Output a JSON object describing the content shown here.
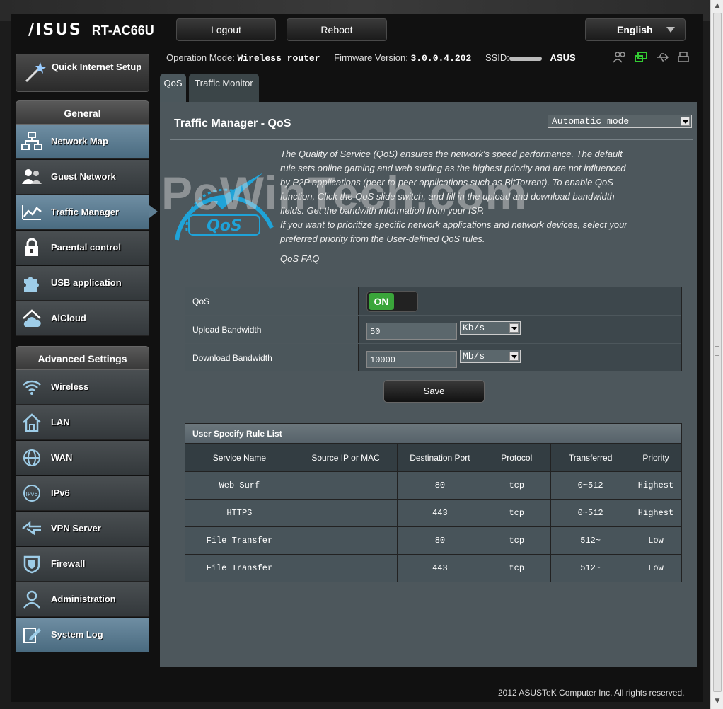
{
  "header": {
    "brand": "/ISUS",
    "model": "RT-AC66U",
    "logout": "Logout",
    "reboot": "Reboot",
    "language": "English"
  },
  "infobar": {
    "op_mode_label": "Operation Mode:",
    "op_mode_value": "Wireless router",
    "fw_label": "Firmware Version:",
    "fw_value": "3.0.0.4.202",
    "ssid_label": "SSID:",
    "ssid_value": "ASUS"
  },
  "sidebar": {
    "qis_label": "Quick Internet Setup",
    "general_title": "General",
    "general_items": [
      {
        "label": "Network Map"
      },
      {
        "label": "Guest Network"
      },
      {
        "label": "Traffic Manager"
      },
      {
        "label": "Parental control"
      },
      {
        "label": "USB application"
      },
      {
        "label": "AiCloud"
      }
    ],
    "advanced_title": "Advanced Settings",
    "advanced_items": [
      {
        "label": "Wireless"
      },
      {
        "label": "LAN"
      },
      {
        "label": "WAN"
      },
      {
        "label": "IPv6"
      },
      {
        "label": "VPN Server"
      },
      {
        "label": "Firewall"
      },
      {
        "label": "Administration"
      },
      {
        "label": "System Log"
      }
    ]
  },
  "tabs": [
    {
      "label": "QoS"
    },
    {
      "label": "Traffic Monitor"
    }
  ],
  "main": {
    "title": "Traffic Manager - QoS",
    "mode_select": "Automatic mode",
    "description_1": "The Quality of Service (QoS) ensures the network's speed performance. The default rule sets online gaming and web surfing as the highest priority and are not influenced by P2P applications (peer-to-peer applications such as BitTorrent). To enable QoS function, Click the QoS slide switch, and fill in the upload and download bandwidth fields. Get the bandwith information from your ISP.",
    "description_2": "If you want to prioritize specific network applications and network devices, select your preferred priority from the User-defined QoS rules.",
    "faq_link": "QoS FAQ",
    "watermark": "PcWinTech.com",
    "logo_text": "QoS",
    "settings": {
      "qos_label": "QoS",
      "qos_state": "ON",
      "upload_label": "Upload Bandwidth",
      "upload_value": "50",
      "upload_unit": "Kb/s",
      "download_label": "Download Bandwidth",
      "download_value": "10000",
      "download_unit": "Mb/s"
    },
    "save_label": "Save",
    "rule_list": {
      "title": "User Specify Rule List",
      "columns": [
        "Service Name",
        "Source IP or MAC",
        "Destination Port",
        "Protocol",
        "Transferred",
        "Priority"
      ],
      "rows": [
        [
          "Web Surf",
          "",
          "80",
          "tcp",
          "0~512",
          "Highest"
        ],
        [
          "HTTPS",
          "",
          "443",
          "tcp",
          "0~512",
          "Highest"
        ],
        [
          "File Transfer",
          "",
          "80",
          "tcp",
          "512~",
          "Low"
        ],
        [
          "File Transfer",
          "",
          "443",
          "tcp",
          "512~",
          "Low"
        ]
      ]
    }
  },
  "footer": "2012 ASUSTeK Computer Inc. All rights reserved.",
  "colors": {
    "panel_bg": "#4d575c",
    "active_menu": "#6f8ea3",
    "toggle_on": "#3aa53a",
    "logo_blue": "#1fa3d8"
  }
}
